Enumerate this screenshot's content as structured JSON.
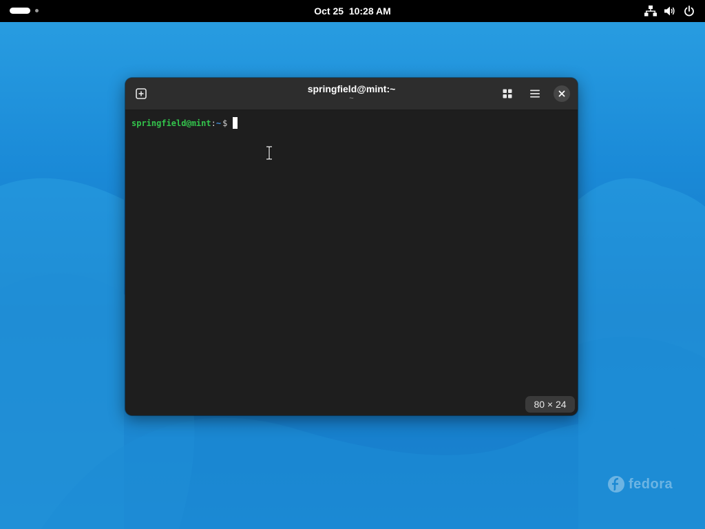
{
  "topbar": {
    "date": "Oct 25",
    "time": "10:28 AM",
    "tray_icons": [
      "network-wired-icon",
      "volume-icon",
      "power-icon"
    ]
  },
  "terminal": {
    "title": "springfield@mint:~",
    "subtitle": "~",
    "prompt_user": "springfield@mint",
    "prompt_sep": ":",
    "prompt_path": "~",
    "prompt_symbol": "$",
    "size_indicator": "80 × 24",
    "header_icons": [
      "new-tab-icon",
      "tab-overview-icon",
      "hamburger-menu-icon",
      "close-icon"
    ]
  },
  "desktop": {
    "watermark": "fedora"
  },
  "colors": {
    "topbar": "#000000",
    "terminal_bg": "#1e1e1e",
    "headerbar": "#2d2d2d",
    "prompt_user": "#33c44c",
    "prompt_path": "#3f8dd8",
    "wallpaper": "#1b8bd8"
  }
}
